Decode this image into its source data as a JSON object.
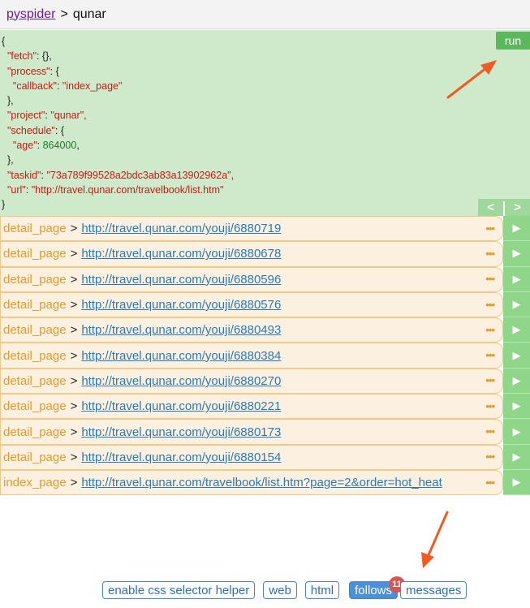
{
  "breadcrumb": {
    "root": "pyspider",
    "separator": ">",
    "project": "qunar"
  },
  "task": {
    "lines": [
      {
        "t": "p",
        "v": "{"
      },
      {
        "t": "kv",
        "indent": 1,
        "k": "\"fetch\"",
        "v": "{},",
        "vt": "p"
      },
      {
        "t": "kv",
        "indent": 1,
        "k": "\"process\"",
        "v": "{",
        "vt": "p"
      },
      {
        "t": "kv",
        "indent": 2,
        "k": "\"callback\"",
        "v": "\"index_page\"",
        "vt": "s"
      },
      {
        "t": "p",
        "indent": 1,
        "v": "},"
      },
      {
        "t": "kv",
        "indent": 1,
        "k": "\"project\"",
        "v": "\"qunar\",",
        "vt": "s"
      },
      {
        "t": "kv",
        "indent": 1,
        "k": "\"schedule\"",
        "v": "{",
        "vt": "p"
      },
      {
        "t": "kv",
        "indent": 2,
        "k": "\"age\"",
        "v": "864000",
        "vt": "n"
      },
      {
        "t": "p",
        "indent": 1,
        "v": "},"
      },
      {
        "t": "kv",
        "indent": 1,
        "k": "\"taskid\"",
        "v": "\"73a789f99528a2bdc3ab83a13902962a\",",
        "vt": "s"
      },
      {
        "t": "kv",
        "indent": 1,
        "k": "\"url\"",
        "v": "\"http://travel.qunar.com/travelbook/list.htm\"",
        "vt": "s"
      },
      {
        "t": "p",
        "v": "}"
      }
    ],
    "run_label": "run",
    "pager_prev": "<",
    "pager_next": ">"
  },
  "follows": [
    {
      "callback": "detail_page",
      "url": "http://travel.qunar.com/youji/6880719"
    },
    {
      "callback": "detail_page",
      "url": "http://travel.qunar.com/youji/6880678"
    },
    {
      "callback": "detail_page",
      "url": "http://travel.qunar.com/youji/6880596"
    },
    {
      "callback": "detail_page",
      "url": "http://travel.qunar.com/youji/6880576"
    },
    {
      "callback": "detail_page",
      "url": "http://travel.qunar.com/youji/6880493"
    },
    {
      "callback": "detail_page",
      "url": "http://travel.qunar.com/youji/6880384"
    },
    {
      "callback": "detail_page",
      "url": "http://travel.qunar.com/youji/6880270"
    },
    {
      "callback": "detail_page",
      "url": "http://travel.qunar.com/youji/6880221"
    },
    {
      "callback": "detail_page",
      "url": "http://travel.qunar.com/youji/6880173"
    },
    {
      "callback": "detail_page",
      "url": "http://travel.qunar.com/youji/6880154"
    },
    {
      "callback": "index_page",
      "url": "http://travel.qunar.com/travelbook/list.htm?page=2&order=hot_heat"
    }
  ],
  "follow_separator": ">",
  "more_glyph": "•••",
  "play_glyph": "▶",
  "tabs": {
    "css_selector": "enable css selector helper",
    "web": "web",
    "html": "html",
    "follows": "follows",
    "follows_badge": "11",
    "messages": "messages"
  },
  "colors": {
    "accent": "#4a8fd8",
    "run": "#5cb85c",
    "callback": "#e69a2b",
    "link": "#2a7ab8",
    "badge": "#d9534f",
    "annotation_arrow": "#f05a23"
  }
}
